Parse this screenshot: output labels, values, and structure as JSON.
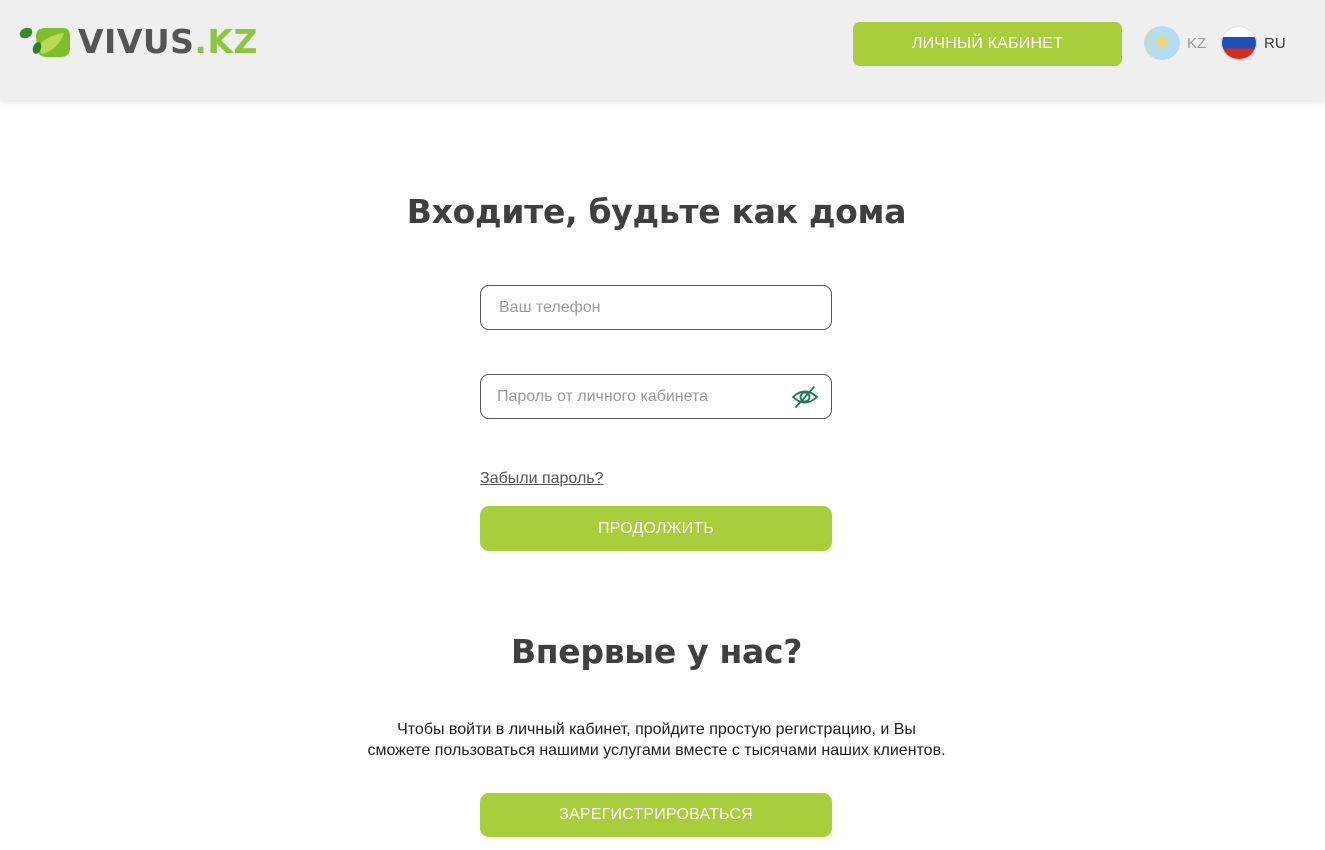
{
  "header": {
    "logo": {
      "brand": "VIVUS",
      "tld": ".KZ"
    },
    "cabinet_button": "ЛИЧНЫЙ КАБИНЕТ",
    "languages": [
      {
        "code": "KZ",
        "flag_icon": "kz-flag-icon",
        "active": false
      },
      {
        "code": "RU",
        "flag_icon": "ru-flag-icon",
        "active": true
      }
    ]
  },
  "login": {
    "title": "Входите, будьте как дома",
    "phone": {
      "value": "",
      "placeholder": "Ваш телефон"
    },
    "password": {
      "value": "",
      "placeholder": "Пароль от личного кабинета",
      "toggle_icon": "eye-slash-icon"
    },
    "forgot_link": "Забыли пароль?",
    "continue_button": "ПРОДОЛЖИТЬ"
  },
  "register": {
    "title": "Впервые у нас?",
    "description_line1": "Чтобы войти в личный кабинет, пройдите простую регистрацию, и Вы",
    "description_line2": "сможете пользоваться нашими услугами вместе с тысячами наших клиентов.",
    "register_button": "ЗАРЕГИСТРИРОВАТЬСЯ"
  },
  "colors": {
    "accent_green": "#a8cf3b",
    "logo_green": "#8cc63f",
    "header_bg": "#efefef",
    "text_dark": "#3f3f3f",
    "eye_icon": "#1f7a4d"
  }
}
